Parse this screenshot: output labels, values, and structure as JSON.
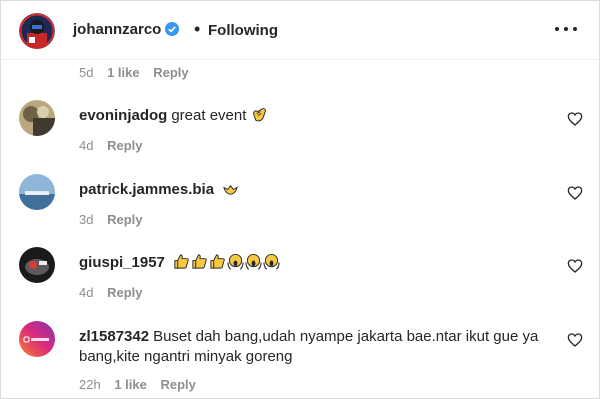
{
  "post": {
    "username": "johannzarco",
    "follow_status": "Following"
  },
  "comments": [
    {
      "username": "",
      "text": "",
      "time": "5d",
      "likes": "1 like",
      "reply": "Reply"
    },
    {
      "username": "evoninjadog",
      "text": "great event",
      "time": "4d",
      "likes": "",
      "reply": "Reply"
    },
    {
      "username": "patrick.jammes.bia",
      "text": "",
      "time": "3d",
      "likes": "",
      "reply": "Reply"
    },
    {
      "username": "giuspi_1957",
      "text": "",
      "time": "4d",
      "likes": "",
      "reply": "Reply"
    },
    {
      "username": "zl1587342",
      "text": "Buset dah bang,udah nyampe jakarta bae.ntar ikut gue ya bang,kite ngantri minyak goreng",
      "time": "22h",
      "likes": "1 like",
      "reply": "Reply"
    }
  ],
  "icons": {
    "verified": "verified-badge-icon",
    "more": "more-options-icon",
    "heart": "heart-outline-icon",
    "clap": "clapping-hands-emoji",
    "thumbs": "thumbs-up-emoji",
    "scream": "screaming-face-emoji"
  },
  "colors": {
    "text": "#262626",
    "secondary": "#8e8e8e",
    "verified": "#3897f0",
    "divider": "#efefef",
    "emoji_yellow": "#f7c843"
  }
}
